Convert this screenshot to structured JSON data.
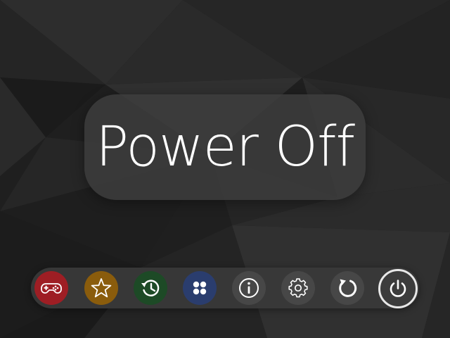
{
  "screen": {
    "title": "Power Off"
  },
  "colors": {
    "background": "#1e1e1e",
    "card": "#3c3c3c",
    "games": "#9e1e24",
    "favorites": "#8a5c0c",
    "history": "#1d4a26",
    "collections": "#2a3d6e",
    "neutral": "#474747",
    "selected_ring": "#e8e8e8"
  },
  "dock": {
    "items": [
      {
        "id": "games",
        "icon": "gamepad-icon",
        "selected": false
      },
      {
        "id": "favorites",
        "icon": "star-icon",
        "selected": false
      },
      {
        "id": "history",
        "icon": "history-icon",
        "selected": false
      },
      {
        "id": "collections",
        "icon": "collections-icon",
        "selected": false
      },
      {
        "id": "info",
        "icon": "info-icon",
        "selected": false
      },
      {
        "id": "settings",
        "icon": "gear-icon",
        "selected": false
      },
      {
        "id": "restart",
        "icon": "restart-icon",
        "selected": false
      },
      {
        "id": "power",
        "icon": "power-icon",
        "selected": true
      }
    ]
  }
}
